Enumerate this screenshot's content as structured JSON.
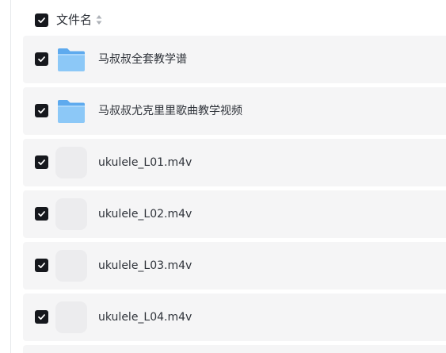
{
  "header": {
    "column_label": "文件名",
    "select_all_checked": true,
    "sort_icon": "sort-icon"
  },
  "rows": [
    {
      "name": "马叔叔全套教学谱",
      "type": "folder",
      "checked": true,
      "icon": "folder-icon"
    },
    {
      "name": "马叔叔尤克里里歌曲教学视频",
      "type": "folder",
      "checked": true,
      "icon": "folder-icon"
    },
    {
      "name": "ukulele_L01.m4v",
      "type": "file",
      "checked": true,
      "icon": "video-file-icon"
    },
    {
      "name": "ukulele_L02.m4v",
      "type": "file",
      "checked": true,
      "icon": "video-file-icon"
    },
    {
      "name": "ukulele_L03.m4v",
      "type": "file",
      "checked": true,
      "icon": "video-file-icon"
    },
    {
      "name": "ukulele_L04.m4v",
      "type": "file",
      "checked": true,
      "icon": "video-file-icon"
    }
  ],
  "colors": {
    "row_background": "#f5f5f6",
    "checkbox": "#16181d",
    "folder_front": "#8cc8f7",
    "folder_back": "#5eaaee"
  }
}
